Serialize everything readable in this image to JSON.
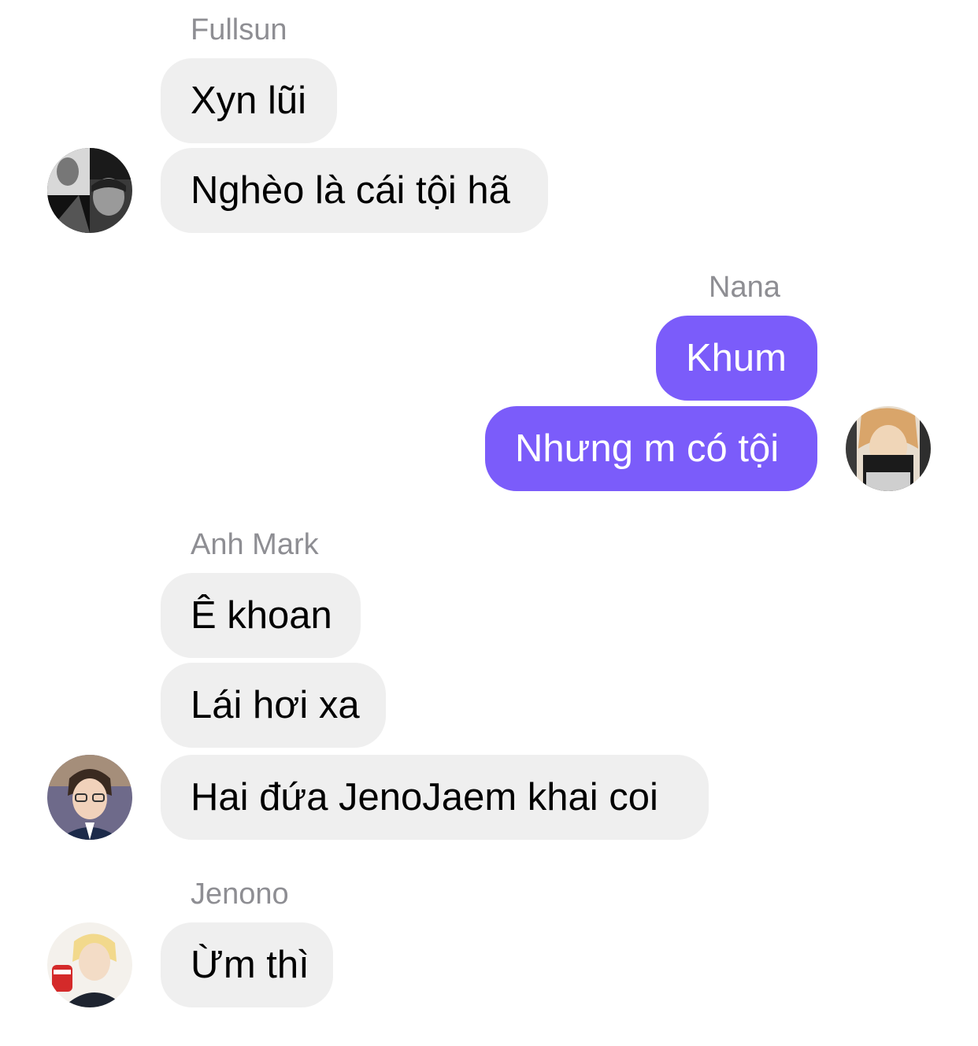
{
  "groups": [
    {
      "sender": "Fullsun",
      "avatar_icon": "avatar-fullsun",
      "messages": [
        "Xyn lũi",
        "Nghèo là cái tội hã"
      ]
    },
    {
      "sender": "Nana",
      "avatar_icon": "avatar-nana",
      "messages": [
        "Khum",
        "Nhưng m có tội"
      ]
    },
    {
      "sender": "Anh Mark",
      "avatar_icon": "avatar-anh-mark",
      "messages": [
        "Ê khoan",
        "Lái hơi xa",
        "Hai đứa JenoJaem khai coi"
      ]
    },
    {
      "sender": "Jenono",
      "avatar_icon": "avatar-jenono",
      "messages": [
        "Ừm thì"
      ]
    }
  ],
  "colors": {
    "incoming_bubble": "#efefef",
    "outgoing_bubble": "#7b5cfa",
    "sender_name": "#8e8e93"
  }
}
